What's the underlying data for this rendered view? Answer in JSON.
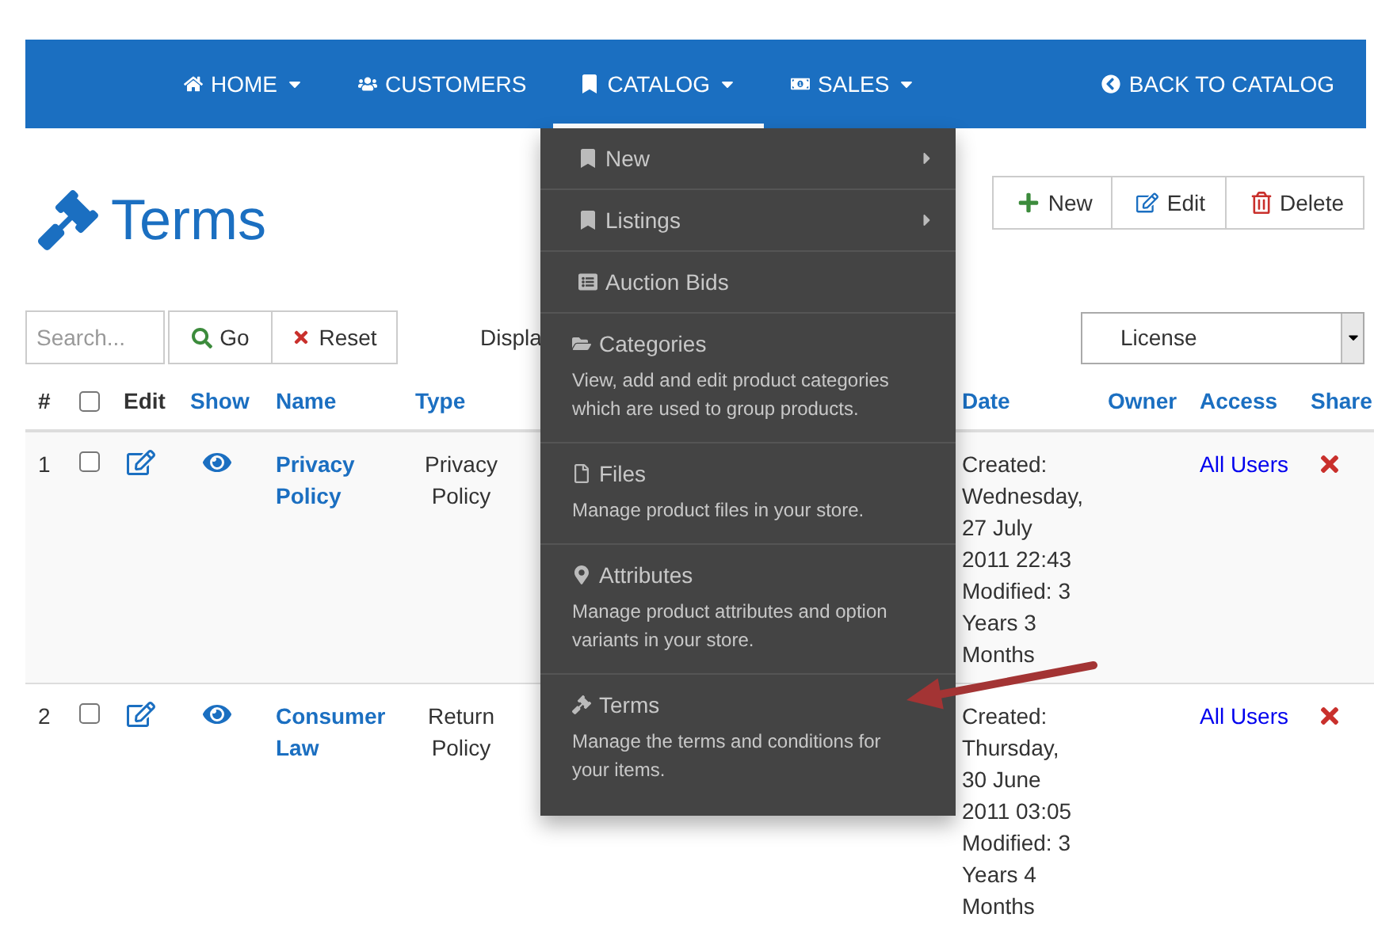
{
  "nav": {
    "items": [
      {
        "label": "HOME",
        "caret": true,
        "selected": false
      },
      {
        "label": "CUSTOMERS",
        "caret": false,
        "selected": false
      },
      {
        "label": "CATALOG",
        "caret": true,
        "selected": true
      },
      {
        "label": "SALES",
        "caret": true,
        "selected": false
      }
    ],
    "back": "BACK TO CATALOG"
  },
  "dropdown": [
    {
      "kind": "submenu",
      "label": "New"
    },
    {
      "kind": "submenu",
      "label": "Listings"
    },
    {
      "kind": "link",
      "label": "Auction Bids"
    },
    {
      "kind": "described",
      "label": "Categories",
      "description": "View, add and edit product categories which are used to group products."
    },
    {
      "kind": "described",
      "label": "Files",
      "description": "Manage product files in your store."
    },
    {
      "kind": "described",
      "label": "Attributes",
      "description": "Manage product attributes and option variants in your store."
    },
    {
      "kind": "described",
      "label": "Terms",
      "description": "Manage the terms and conditions for your items."
    }
  ],
  "page_title": "Terms",
  "actions": [
    "New",
    "Edit",
    "Delete"
  ],
  "search": {
    "placeholder": "Search...",
    "go": "Go",
    "reset": "Reset"
  },
  "display_label": "Displa",
  "filter": {
    "value": "License"
  },
  "table": {
    "columns": [
      "#",
      "Edit",
      "Show",
      "Name",
      "Type",
      "Date",
      "Owner",
      "Access",
      "Share"
    ],
    "all_checked": false,
    "rows": [
      {
        "number": "1",
        "checked": false,
        "name": "Privacy Policy",
        "type": "Privacy Policy",
        "date": [
          "Created:",
          "Wednesday,",
          "27 July",
          "2011 22:43",
          "Modified: 3",
          "Years 3",
          "Months"
        ],
        "access": "All Users"
      },
      {
        "number": "2",
        "checked": false,
        "name": "Consumer Law",
        "type": "Return Policy",
        "date": [
          "Created:",
          "Thursday,",
          "30 June",
          "2011 03:05",
          "Modified: 3",
          "Years 4",
          "Months"
        ],
        "access": "All Users"
      }
    ]
  }
}
